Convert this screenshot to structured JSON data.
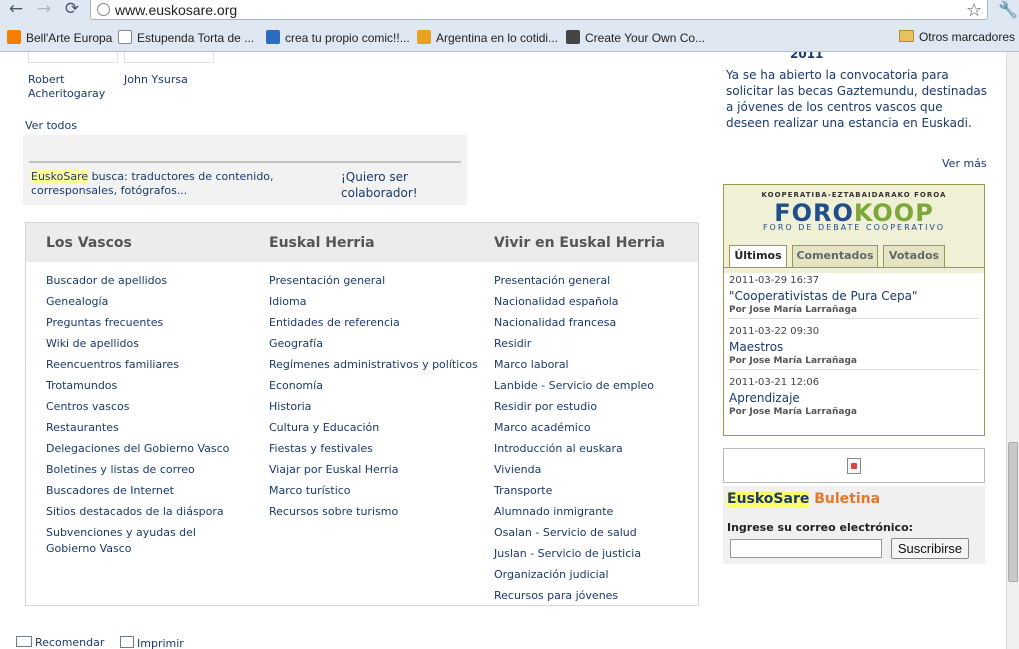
{
  "browser": {
    "url": "www.euskosare.org",
    "back_glyph": "←",
    "forward_glyph": "→",
    "reload_glyph": "⟳",
    "star_glyph": "☆",
    "wrench_glyph": "🔧",
    "bookmarks": [
      {
        "label": "Bell'Arte Europa",
        "icon": "blogger-icon",
        "color": "#f57d00"
      },
      {
        "label": "Estupenda Torta de ...",
        "icon": "page-icon",
        "color": "#ffffff"
      },
      {
        "label": "crea tu propio comic!!...",
        "icon": "t-icon",
        "color": "#2a6cc0"
      },
      {
        "label": "Argentina en lo cotidi...",
        "icon": "image-icon",
        "color": "#e8a020"
      },
      {
        "label": "Create Your Own Co...",
        "icon": "mask-icon",
        "color": "#444444"
      }
    ],
    "other_bookmarks": "Otros marcadores"
  },
  "people": [
    "Robert Acheritogaray",
    "John Ysursa"
  ],
  "ver_todos": "Ver todos",
  "collab": {
    "brand": "EuskoSare",
    "text": " busca: traductores de contenido, corresponsales, fotógrafos...",
    "link": "¡Quiero ser colaborador!"
  },
  "directory": {
    "headers": [
      "Los Vascos",
      "Euskal Herria",
      "Vivir en Euskal Herria"
    ],
    "col1": [
      "Buscador de apellidos",
      "Genealogía",
      "Preguntas frecuentes",
      "Wiki de apellidos",
      "Reencuentros familiares",
      "Trotamundos",
      "Centros vascos",
      "Restaurantes",
      "Delegaciones del Gobierno Vasco",
      "Boletines y listas de correo",
      "Buscadores de Internet",
      "Sitios destacados de la diáspora",
      "Subvenciones y ayudas del Gobierno Vasco"
    ],
    "col2": [
      "Presentación general",
      "Idioma",
      "Entidades de referencia",
      "Geografía",
      "Regímenes administrativos y políticos",
      "Economía",
      "Historia",
      "Cultura y Educación",
      "Fiestas y festivales",
      "Viajar por Euskal Herria",
      "Marco turístico",
      "Recursos sobre turismo"
    ],
    "col3": [
      "Presentación general",
      "Nacionalidad española",
      "Nacionalidad francesa",
      "Residir",
      "Marco laboral",
      "Lanbide - Servicio de empleo",
      "Residir por estudio",
      "Marco académico",
      "Introducción al euskara",
      "Vivienda",
      "Transporte",
      "Alumnado inmigrante",
      "Osalan - Servicio de salud",
      "Juslan - Servicio de justicia",
      "Organización judicial",
      "Recursos para jóvenes"
    ]
  },
  "actions": {
    "recommend": "Recomendar",
    "print": "Imprimir"
  },
  "news": {
    "year": "2011",
    "text": "Ya se ha abierto la convocatoria para solicitar las becas Gaztemundu, destinadas a jóvenes de los centros vascos que deseen realizar una estancia en Euskadi.",
    "ver_mas": "Ver más"
  },
  "forokoop": {
    "subtitle": "KOOPERATIBA-EZTABAIDARAKO FOROA",
    "logo_a": "FORO",
    "logo_b": "KOOP",
    "tagline": "FORO DE DEBATE COOPERATIVO",
    "tabs": [
      "Últimos",
      "Comentados",
      "Votados"
    ],
    "posts": [
      {
        "date": "2011-03-29 16:37",
        "title": "\"Cooperativistas de Pura Cepa\"",
        "author": "Por Jose María Larrañaga"
      },
      {
        "date": "2011-03-22 09:30",
        "title": "Maestros",
        "author": "Por Jose María Larrañaga"
      },
      {
        "date": "2011-03-21 12:06",
        "title": "Aprendizaje",
        "author": "Por Jose María Larrañaga"
      }
    ]
  },
  "bulletin": {
    "brand": "EuskoSare",
    "word": "Buletina",
    "label": "Ingrese su correo electrónico:",
    "button": "Suscribirse",
    "brand_bg": "#ffff66",
    "word_color": "#e8752a"
  }
}
